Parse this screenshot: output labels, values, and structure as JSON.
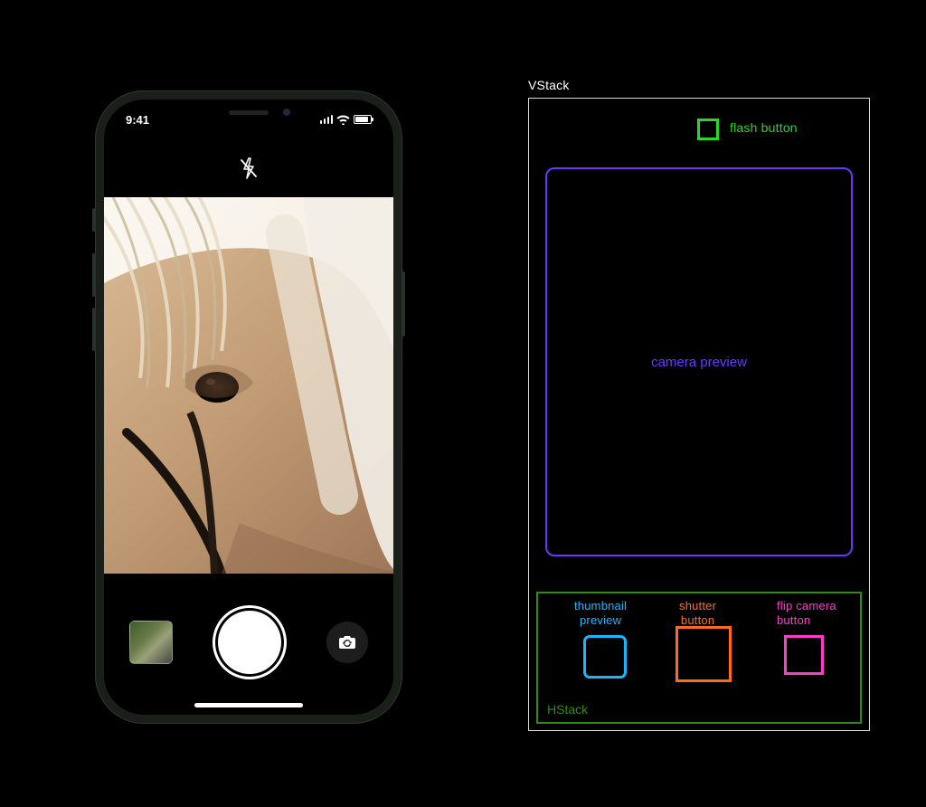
{
  "phone": {
    "status": {
      "time": "9:41"
    }
  },
  "diagram": {
    "vstack_label": "VStack",
    "hstack_label": "HStack",
    "flash_label": "flash button",
    "camera_preview_label": "camera preview",
    "thumbnail_label": "thumbnail\npreview",
    "shutter_label": "shutter\nbutton",
    "flip_label": "flip camera\nbutton"
  }
}
